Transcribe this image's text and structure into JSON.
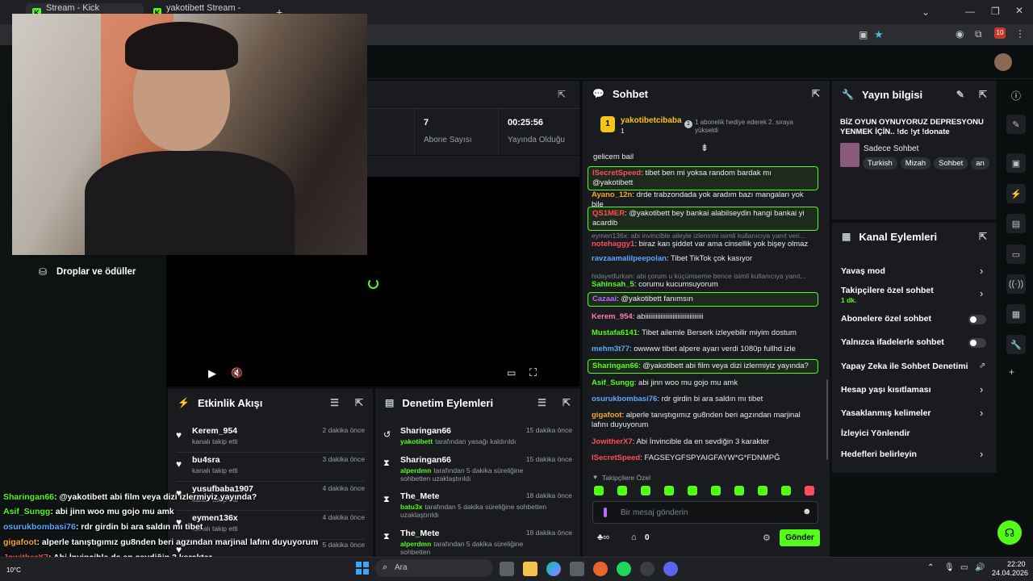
{
  "browser": {
    "tabs": [
      {
        "title": "Stream - Kick Dashboard"
      },
      {
        "title": "yakotibett Stream - Watch Live"
      }
    ]
  },
  "stats": {
    "subscribers_value": "7",
    "subscribers_label": "Abone Sayısı",
    "live_time_value": "00:25:56",
    "live_time_label": "Yayında Olduğu"
  },
  "drops_label": "Droplar ve ödüller",
  "chat": {
    "title": "Sohbet",
    "pinned_user": "yakotibetcibaba",
    "pinned_user_badge": "1",
    "pinned_rank": "1",
    "pinned_rank_icon": "1",
    "pinned_text": "1 abonelik hediye ederek 2. sıraya yükseldi",
    "first_line": "gelicem bail",
    "messages": [
      {
        "user": "ISecretSpeed",
        "color": "#ff4d5a",
        "text": ": tibet ben mi yoksa random bardak mı @yakotibett",
        "hl": true
      },
      {
        "user": "Ayano_12n",
        "color": "#f5a623",
        "text": ": drde trabzondada yok aradım bazı mangaları yok bile",
        "hl": false
      },
      {
        "user": "QS1MER",
        "color": "#ff4d5a",
        "text": ": @yakotibett bey bankai alabilseydin hangi bankai yi acardib",
        "hl": true
      },
      {
        "reply": "eymen136x: abi invincible aileyle izlenirmi isimli kullanıcıya yanıt veri..."
      },
      {
        "user": "notehaggy1",
        "color": "#ff4d5a",
        "text": ": biraz kan şiddet var ama cinsellik yok bişey olmaz",
        "hl": false
      },
      {
        "user": "ravzaamalilpeepolan",
        "color": "#5aa9ff",
        "text": ": Tibet TikTok çok kasıyor",
        "hl": false
      },
      {
        "reply": "hidayetfurkan: abi çorum u küçümseme bence isimli kullanıcıya yanıt..."
      },
      {
        "user": "Sahinsah_5",
        "color": "#53fc18",
        "text": ": corumu kucumsuyorum",
        "hl": false
      },
      {
        "user": "Cazaai",
        "color": "#b56bff",
        "text": ": @yakotibett fanımsın",
        "hl": true
      },
      {
        "user": "Kerem_954",
        "color": "#ff7ab6",
        "text": ": abiiiiiiiiiiiiiiiiiiiiiiiiiiiiiiiiii",
        "hl": false
      },
      {
        "user": "Mustafa6141",
        "color": "#53fc18",
        "text": ": Tibet ailemle Berserk izleyebilir miyim dostum",
        "hl": false
      },
      {
        "user": "mehm3t77",
        "color": "#5aa9ff",
        "text": ": owwww tibet alpere ayarı verdi 1080p fullhd izle",
        "hl": false
      },
      {
        "user": "Sharingan66",
        "color": "#53fc18",
        "text": ": @yakotibett abi film veya dizi izlermiyiz yayında?",
        "hl": true
      },
      {
        "user": "Asif_Sungg",
        "color": "#53fc18",
        "text": ": abi jinn woo mu gojo mu amk",
        "hl": false
      },
      {
        "user": "osurukbombasi76",
        "color": "#5aa9ff",
        "text": ": rdr girdin bi ara saldın mı tibet",
        "hl": false
      },
      {
        "user": "gigafoot",
        "color": "#f5a623",
        "text": ": alperle tanıştıgımız gu8nden beri agzından marjinal lafını duyuyorum",
        "hl": false
      },
      {
        "user": "JowitherX7",
        "color": "#ff4d5a",
        "text": ": Abi İnvincible da en sevdiğin 3 karakter",
        "hl": false
      },
      {
        "user": "ISecretSpeed",
        "color": "#ff4d5a",
        "text": ": FAGSEYGFSPYAIGFAYW*G*FDNMPĞ",
        "hl": false
      }
    ],
    "followers_only": "Takipçilere Özel",
    "input_placeholder": "Bir mesaj gönderin",
    "points": "0",
    "send_label": "Gönder"
  },
  "stream_info": {
    "title": "Yayın bilgisi",
    "stream_title": "BİZ OYUN OYNUYORUZ DEPRESYONU YENMEK İÇİN.. !dc !yt !donate",
    "category": "Sadece Sohbet",
    "tags": [
      "Turkish",
      "Mizah",
      "Sohbet",
      "an"
    ]
  },
  "channel_actions": {
    "title": "Kanal Eylemleri",
    "rows": [
      {
        "label": "Yavaş mod",
        "sub": "",
        "kind": "chev"
      },
      {
        "label": "Takipçilere özel sohbet",
        "sub": "1 dk.",
        "kind": "chev"
      },
      {
        "label": "Abonelere özel sohbet",
        "sub": "",
        "kind": "toggle"
      },
      {
        "label": "Yalnızca ifadelerle sohbet",
        "sub": "",
        "kind": "toggle"
      },
      {
        "label": "Yapay Zeka ile Sohbet Denetimi",
        "sub": "",
        "kind": "ext"
      },
      {
        "label": "Hesap yaşı kısıtlaması",
        "sub": "",
        "kind": "chev"
      },
      {
        "label": "Yasaklanmış kelimeler",
        "sub": "",
        "kind": "chev"
      },
      {
        "label": "İzleyici Yönlendir",
        "sub": "",
        "kind": "none"
      },
      {
        "label": "Hedefleri belirleyin",
        "sub": "",
        "kind": "chev"
      }
    ]
  },
  "activity": {
    "title": "Etkinlik Akışı",
    "items": [
      {
        "name": "Kerem_954",
        "sub": "kanalı takip etti",
        "time": "2 dakika önce"
      },
      {
        "name": "bu4sra",
        "sub": "kanalı takip etti",
        "time": "3 dakika önce"
      },
      {
        "name": "yusufbaba1907",
        "sub": "kanalı takip etti",
        "time": "4 dakika önce"
      },
      {
        "name": "eymen136x",
        "sub": "kanalı takip etti",
        "time": "4 dakika önce"
      },
      {
        "name": "",
        "sub": "",
        "time": "5 dakika önce"
      }
    ]
  },
  "moderation": {
    "title": "Denetim Eylemleri",
    "items": [
      {
        "name": "Sharingan66",
        "mod": "yakotibett",
        "sub": "tarafından yasağı kaldırıldı",
        "time": "15 dakika önce"
      },
      {
        "name": "Sharingan66",
        "mod": "alperdmn",
        "sub": "tarafından 5 dakika süreliğine sohbetten uzaklaştırıldı",
        "time": "15 dakika önce"
      },
      {
        "name": "The_Mete",
        "mod": "batu3x",
        "sub": "tarafından 5 dakika süreliğine sohbetten uzaklaştırıldı",
        "time": "18 dakika önce"
      },
      {
        "name": "The_Mete",
        "mod": "alperdmn",
        "sub": "tarafından 5 dakika süreliğine sohbetten",
        "time": "18 dakika önce"
      }
    ]
  },
  "overlay": {
    "lines": [
      {
        "user": "Sharingan66",
        "text": ": @yakotibett abi film veya dizi izlermiyiz yayında?",
        "color": "#53fc18"
      },
      {
        "user": "Asif_Sungg",
        "text": ": abi jinn woo mu gojo mu amk",
        "color": "#53fc18"
      },
      {
        "user": "osurukbombasi76",
        "text": ": rdr girdin bi ara saldın mı tibet",
        "color": "#5aa9ff"
      },
      {
        "user": "gigafoot",
        "text": ": alperle tanıştıgımız gu8nden beri agzından marjinal lafını duyuyorum",
        "color": "#f5a623"
      },
      {
        "user": "JowitherX7",
        "text": ": Abi İnvincible da en sevdiğin 3 karakter",
        "color": "#ff4d5a"
      },
      {
        "user": "ISecretSpeed",
        "text": ": FAGSEYGFSPYAIGFAYW*G*FDNMPĞ",
        "color": "#ff4d5a"
      }
    ]
  },
  "taskbar": {
    "search": "Ara",
    "weather": "10°C",
    "time": "22:20",
    "date": "24.04.2026",
    "notif_badge": "10"
  },
  "colors": {
    "accent": "#53fc18",
    "panel": "#191b1f",
    "bg": "#0b0e0f"
  }
}
